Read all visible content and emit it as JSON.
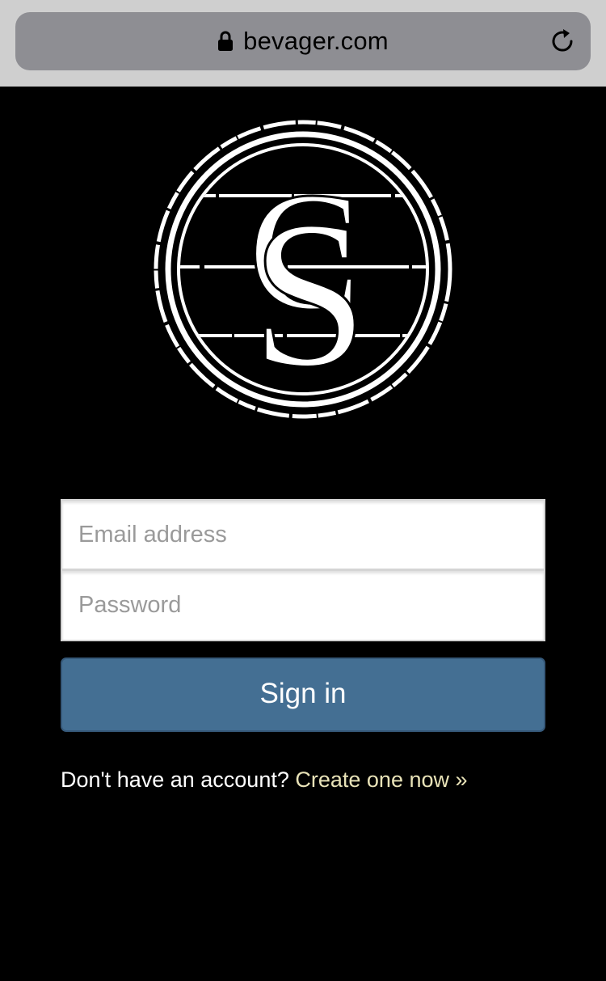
{
  "browser": {
    "url": "bevager.com",
    "lock_icon": "lock-icon",
    "reload_icon": "reload-icon"
  },
  "logo": {
    "lettering": "CS",
    "colors": {
      "mark": "#ffffff",
      "background": "#000000"
    }
  },
  "login_form": {
    "email_placeholder": "Email address",
    "password_placeholder": "Password",
    "signin_label": "Sign in",
    "signup_prompt": "Don't have an account?",
    "signup_link": "Create one now »"
  },
  "colors": {
    "browser_bar": "#cfcfcf",
    "address_pill": "#8e8e93",
    "page_background": "#000000",
    "button": "#446f93",
    "link": "#e9e3b8"
  }
}
